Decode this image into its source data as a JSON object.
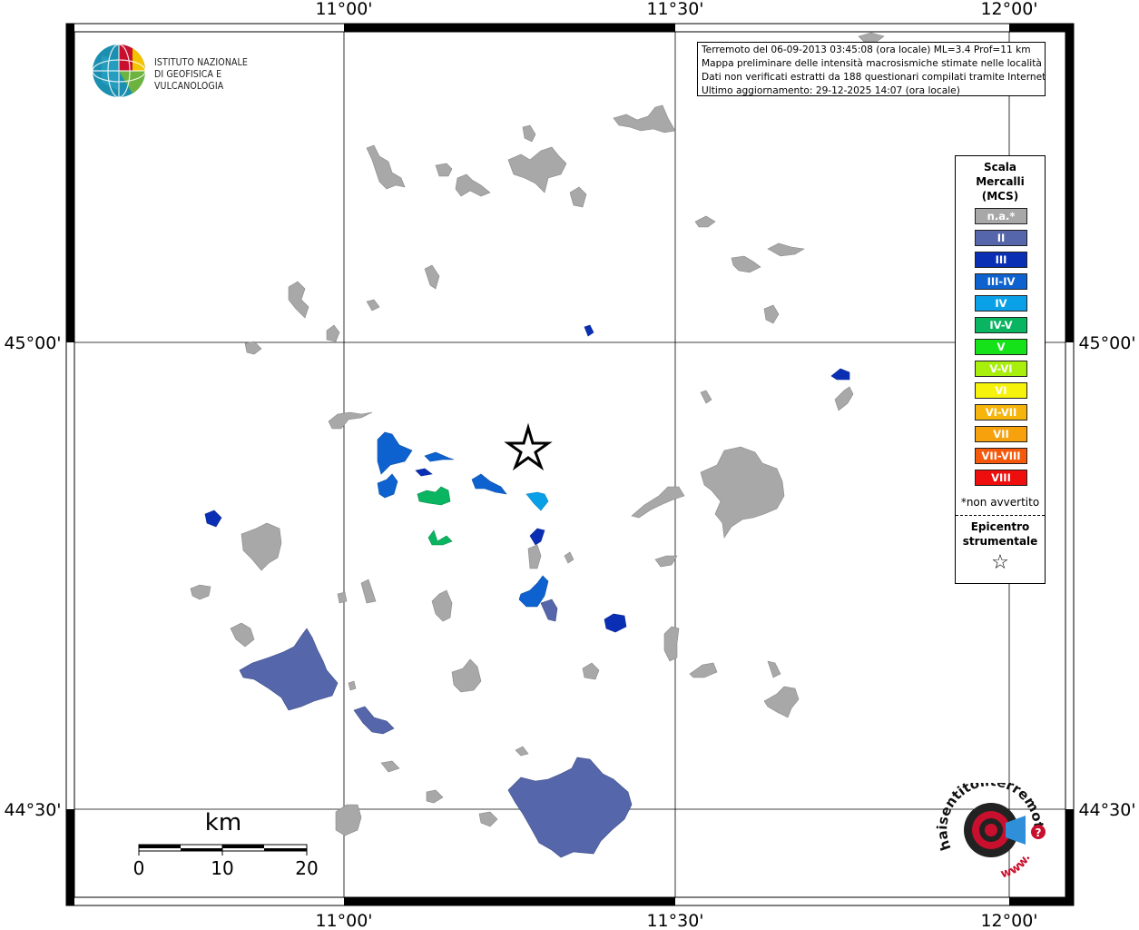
{
  "map": {
    "axis": {
      "top_lon_labels": [
        "11°00'",
        "11°30'",
        "12°00'"
      ],
      "bottom_lon_labels": [
        "11°00'",
        "11°30'",
        "12°00'"
      ],
      "left_lat_labels": [
        "45°00'",
        "44°30'"
      ],
      "right_lat_labels": [
        "45°00'",
        "44°30'"
      ]
    },
    "info": {
      "line1": "Terremoto del 06-09-2013 03:45:08 (ora locale) ML=3.4 Prof=11 km",
      "line2": "Mappa preliminare delle intensità macrosismiche stimate nelle località",
      "line3": "Dati non verificati estratti da 188 questionari compilati tramite Internet.",
      "line4": "Ultimo aggiornamento: 29-12-2025 14:07 (ora locale)"
    },
    "institute": {
      "line1": "ISTITUTO NAZIONALE",
      "line2": "DI GEOFISICA E VULCANOLOGIA"
    },
    "legend": {
      "title_line1": "Scala",
      "title_line2": "Mercalli",
      "title_line3": "(MCS)",
      "classes": [
        {
          "label": "n.a.*",
          "color": "#a8a8a8"
        },
        {
          "label": "II",
          "color": "#5566aa"
        },
        {
          "label": "III",
          "color": "#0a2fb5"
        },
        {
          "label": "III-IV",
          "color": "#0d62cf"
        },
        {
          "label": "IV",
          "color": "#0aa0e8"
        },
        {
          "label": "IV-V",
          "color": "#0ab562"
        },
        {
          "label": "V",
          "color": "#16e21a"
        },
        {
          "label": "V-VI",
          "color": "#a8ef0c"
        },
        {
          "label": "VI",
          "color": "#f7f20c"
        },
        {
          "label": "VI-VII",
          "color": "#f5b50c"
        },
        {
          "label": "VII",
          "color": "#f7a10c"
        },
        {
          "label": "VII-VIII",
          "color": "#f55a0c"
        },
        {
          "label": "VIII",
          "color": "#ee0e0e"
        }
      ],
      "note": "*non avvertito",
      "epicenter_line1": "Epicentro",
      "epicenter_line2": "strumentale",
      "star_symbol": "☆"
    },
    "scale_bar": {
      "unit": "km",
      "ticks": [
        "0",
        "10",
        "20"
      ]
    },
    "logo_hsi": {
      "text_top": "haisentitoilterremoto.it",
      "text_bottom": "www."
    },
    "colors": {
      "na": "#a8a8a8",
      "II": "#5566aa",
      "III": "#0a2fb5",
      "III-IV": "#0d62cf",
      "IV": "#0aa0e8",
      "IV-V": "#0ab562"
    }
  }
}
